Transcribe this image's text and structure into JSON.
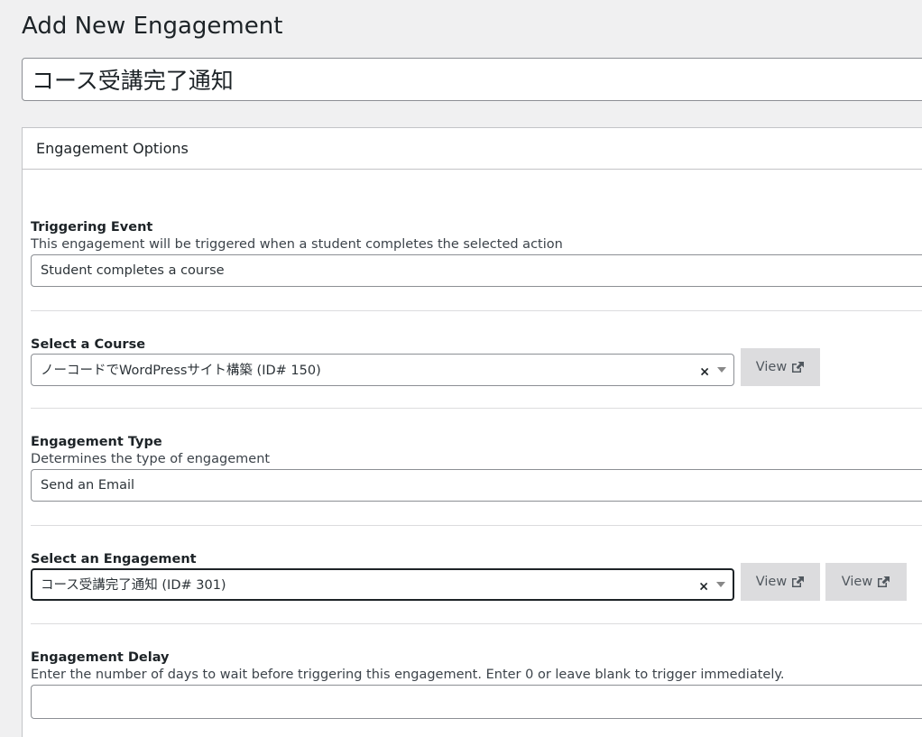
{
  "page": {
    "title": "Add New Engagement",
    "post_title_value": "コース受講完了通知"
  },
  "metabox": {
    "title": "Engagement Options"
  },
  "triggering_event": {
    "label": "Triggering Event",
    "description": "This engagement will be triggered when a student completes the selected action",
    "value": "Student completes a course"
  },
  "select_course": {
    "label": "Select a Course",
    "value": "ノーコードでWordPressサイト構築 (ID# 150)",
    "clear_glyph": "×",
    "view_label": "View"
  },
  "engagement_type": {
    "label": "Engagement Type",
    "description": "Determines the type of engagement",
    "value": "Send an Email"
  },
  "select_engagement": {
    "label": "Select an Engagement",
    "value": "コース受講完了通知 (ID# 301)",
    "clear_glyph": "×",
    "view_label": "View",
    "view_label_2": "View"
  },
  "engagement_delay": {
    "label": "Engagement Delay",
    "description": "Enter the number of days to wait before triggering this engagement. Enter 0 or leave blank to trigger immediately.",
    "value": ""
  }
}
